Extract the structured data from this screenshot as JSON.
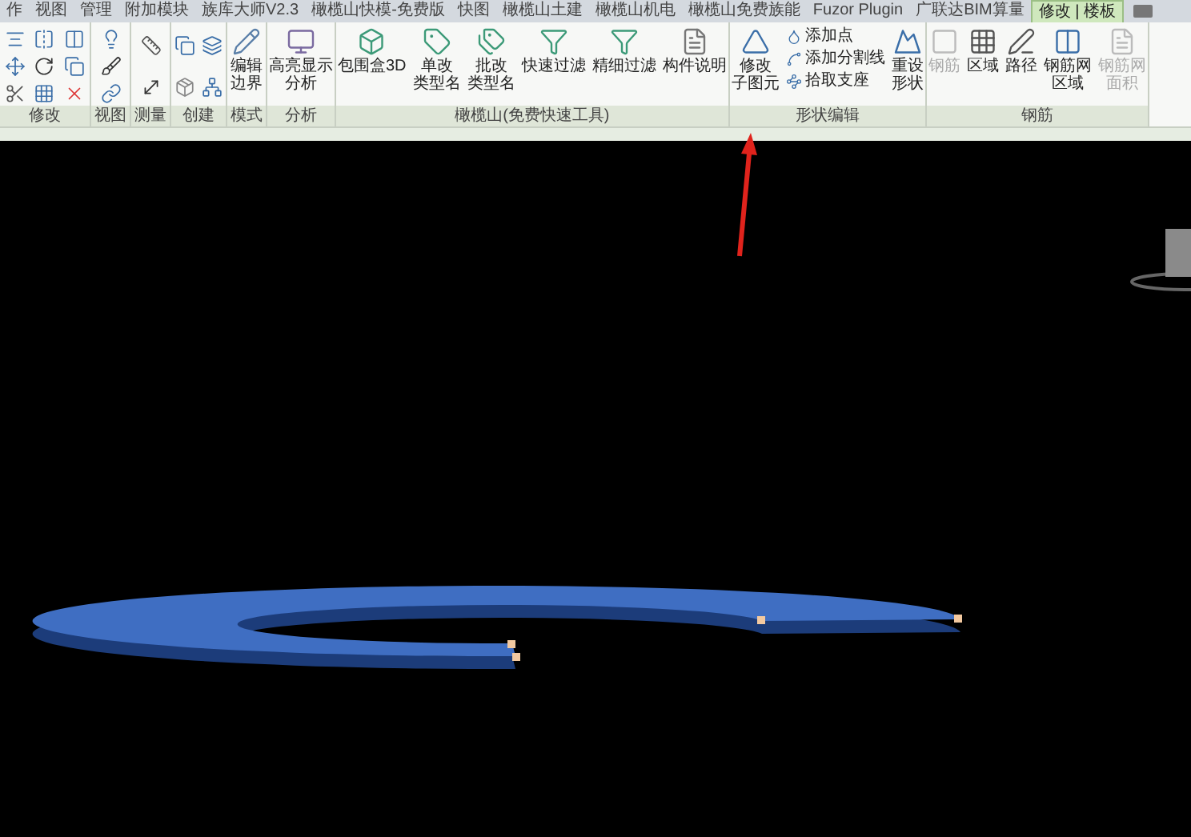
{
  "tabs": [
    {
      "label": "作",
      "selected": false
    },
    {
      "label": "视图",
      "selected": false
    },
    {
      "label": "管理",
      "selected": false
    },
    {
      "label": "附加模块",
      "selected": false
    },
    {
      "label": "族库大师V2.3",
      "selected": false
    },
    {
      "label": "橄榄山快模-免费版",
      "selected": false
    },
    {
      "label": "快图",
      "selected": false
    },
    {
      "label": "橄榄山土建",
      "selected": false
    },
    {
      "label": "橄榄山机电",
      "selected": false
    },
    {
      "label": "橄榄山免费族能",
      "selected": false
    },
    {
      "label": "Fuzor Plugin",
      "selected": false
    },
    {
      "label": "广联达BIM算量",
      "selected": false
    },
    {
      "label": "修改 | 楼板",
      "selected": true
    }
  ],
  "panels": [
    {
      "label": "修改",
      "kind": "modify"
    },
    {
      "label": "视图",
      "kind": "view"
    },
    {
      "label": "测量",
      "kind": "measure"
    },
    {
      "label": "创建",
      "kind": "create"
    },
    {
      "label": "模式",
      "kind": "tools",
      "tools": [
        {
          "kind": "large",
          "lines": [
            "编辑",
            "边界"
          ],
          "disabled": false
        }
      ]
    },
    {
      "label": "分析",
      "kind": "tools",
      "tools": [
        {
          "kind": "large",
          "lines": [
            "高亮显示",
            "分析"
          ],
          "disabled": false
        }
      ]
    },
    {
      "label": "橄榄山(免费快速工具)",
      "kind": "tools",
      "tools": [
        {
          "kind": "large",
          "lines": [
            "包围盒3D"
          ],
          "disabled": false
        },
        {
          "kind": "large",
          "lines": [
            "单改",
            "类型名"
          ],
          "disabled": false
        },
        {
          "kind": "large",
          "lines": [
            "批改",
            "类型名"
          ],
          "disabled": false
        },
        {
          "kind": "large",
          "lines": [
            "快速过滤"
          ],
          "disabled": false
        },
        {
          "kind": "large",
          "lines": [
            "精细过滤"
          ],
          "disabled": false
        },
        {
          "kind": "large",
          "lines": [
            "构件说明"
          ],
          "disabled": false
        }
      ]
    },
    {
      "label": "形状编辑",
      "kind": "tools",
      "tools": [
        {
          "kind": "large",
          "lines": [
            "修改",
            "子图元"
          ],
          "disabled": false
        },
        {
          "kind": "small",
          "lines": [
            "添加点"
          ],
          "disabled": false
        },
        {
          "kind": "small",
          "lines": [
            "添加分割线"
          ],
          "disabled": false
        },
        {
          "kind": "small",
          "lines": [
            "拾取支座"
          ],
          "disabled": false
        },
        {
          "kind": "large",
          "lines": [
            "重设",
            "形状"
          ],
          "disabled": false
        }
      ]
    },
    {
      "label": "钢筋",
      "kind": "tools",
      "tools": [
        {
          "kind": "large",
          "lines": [
            "钢筋"
          ],
          "disabled": true
        },
        {
          "kind": "large",
          "lines": [
            "区域"
          ],
          "disabled": false
        },
        {
          "kind": "large",
          "lines": [
            "路径"
          ],
          "disabled": false
        },
        {
          "kind": "large",
          "lines": [
            "钢筋网",
            "区域"
          ],
          "disabled": false
        },
        {
          "kind": "large",
          "lines": [
            "钢筋网",
            "面积"
          ],
          "disabled": true
        }
      ]
    }
  ]
}
